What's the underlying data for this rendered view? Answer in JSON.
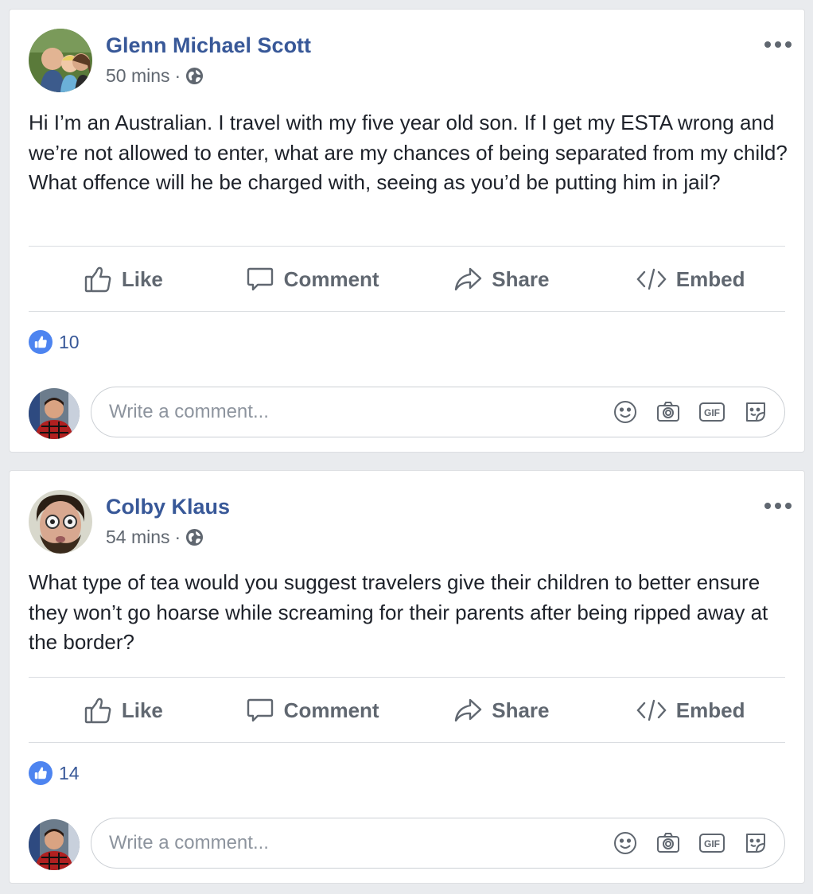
{
  "posts": [
    {
      "author": "Glenn Michael Scott",
      "time": "50 mins",
      "separator": "·",
      "text": "Hi I’m an Australian. I travel with my five year old son. If I get my ESTA wrong and we’re not allowed to enter, what are my chances of being separated from my child? What offence will he be charged with, seeing as you’d be putting him in jail?",
      "like_count": "10"
    },
    {
      "author": "Colby Klaus",
      "time": "54 mins",
      "separator": "·",
      "text": "What type of tea would you suggest travelers give their children to better ensure they won’t go hoarse while screaming for their parents after being ripped away at the border?",
      "like_count": "14"
    }
  ],
  "actions": {
    "like": "Like",
    "comment": "Comment",
    "share": "Share",
    "embed": "Embed"
  },
  "composer": {
    "placeholder": "Write a comment...",
    "icons": [
      "smiley-icon",
      "camera-icon",
      "gif-icon",
      "sticker-icon"
    ]
  },
  "colors": {
    "author": "#385898",
    "muted": "#606770",
    "like_badge": "#4d84f0",
    "background": "#e9ebee"
  }
}
